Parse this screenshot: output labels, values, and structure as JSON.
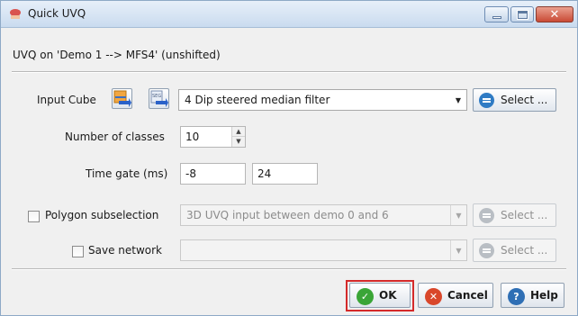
{
  "window": {
    "title": "Quick UVQ",
    "icon": "app-icon"
  },
  "header": {
    "subtitle": "UVQ on 'Demo 1 --> MFS4' (unshifted)"
  },
  "input_cube": {
    "label": "Input Cube",
    "value": "4 Dip steered median filter",
    "select_label": "Select ..."
  },
  "classes": {
    "label": "Number of classes",
    "value": "10"
  },
  "time_gate": {
    "label": "Time gate (ms)",
    "start": "-8",
    "stop": "24"
  },
  "polygon": {
    "label": "Polygon subselection",
    "checked": false,
    "value": "3D UVQ input between demo 0 and 6",
    "select_label": "Select ..."
  },
  "network": {
    "label": "Save network",
    "checked": false,
    "value": "",
    "select_label": "Select ..."
  },
  "buttons": {
    "ok": "OK",
    "cancel": "Cancel",
    "help": "Help"
  },
  "colors": {
    "ok_icon": "#3aa537",
    "cancel_icon": "#d9472b",
    "help_icon": "#2f6fb5",
    "highlight": "#d42a2a",
    "select_icon": "#2f7bc4"
  }
}
